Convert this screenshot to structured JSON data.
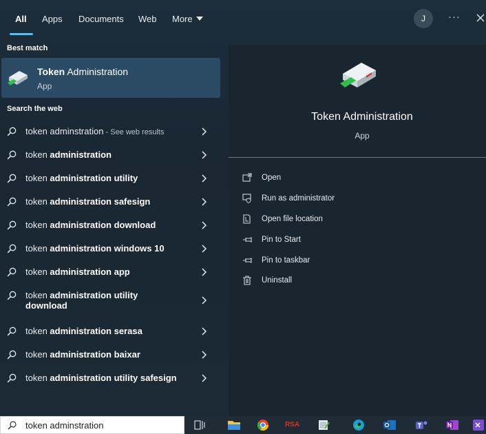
{
  "tabs": [
    {
      "label": "All",
      "active": true
    },
    {
      "label": "Apps"
    },
    {
      "label": "Documents"
    },
    {
      "label": "Web"
    },
    {
      "label": "More"
    }
  ],
  "user": {
    "avatar_initial": "J"
  },
  "header_icons": [
    "more-dots-icon",
    "close-icon"
  ],
  "sections": {
    "best_match": "Best match",
    "search_web": "Search the web"
  },
  "best_match": {
    "title_bold": "Token",
    "title_rest": " Administration",
    "subtitle": "App",
    "icon": "token-admin-app-icon"
  },
  "web_results": [
    {
      "prefix": "token adminstration",
      "bold": "",
      "hint": " - See web results"
    },
    {
      "prefix": "token ",
      "bold": "administration",
      "hint": ""
    },
    {
      "prefix": "token ",
      "bold": "administration utility",
      "hint": ""
    },
    {
      "prefix": "token ",
      "bold": "administration safesign",
      "hint": ""
    },
    {
      "prefix": "token ",
      "bold": "administration download",
      "hint": ""
    },
    {
      "prefix": "token ",
      "bold": "administration windows 10",
      "hint": ""
    },
    {
      "prefix": "token ",
      "bold": "administration app",
      "hint": ""
    },
    {
      "prefix": "token ",
      "bold": "administration utility",
      "line2": "download",
      "hint": ""
    },
    {
      "prefix": "token ",
      "bold": "administration serasa",
      "hint": ""
    },
    {
      "prefix": "token ",
      "bold": "administration baixar",
      "hint": ""
    },
    {
      "prefix": "token ",
      "bold": "administration utility safesign",
      "hint": ""
    }
  ],
  "preview": {
    "title": "Token Administration",
    "subtitle": "App"
  },
  "actions": [
    {
      "label": "Open",
      "icon": "open-icon"
    },
    {
      "label": "Run as administrator",
      "icon": "run-as-admin-icon"
    },
    {
      "label": "Open file location",
      "icon": "file-location-icon"
    },
    {
      "label": "Pin to Start",
      "icon": "pin-icon"
    },
    {
      "label": "Pin to taskbar",
      "icon": "pin-icon"
    },
    {
      "label": "Uninstall",
      "icon": "trash-icon"
    }
  ],
  "search": {
    "value": "token adminstration"
  },
  "taskbar": {
    "rsa_label": "RSA",
    "apps": [
      "task-view-icon",
      "file-explorer-icon",
      "chrome-icon",
      "rsa-icon",
      "notepad-icon",
      "edge-icon",
      "outlook-icon",
      "teams-icon",
      "onenote-icon",
      "visual-studio-icon"
    ]
  },
  "colors": {
    "accent": "#4cc2ff",
    "selection": "#2b4a63",
    "panel": "#1a2733"
  }
}
